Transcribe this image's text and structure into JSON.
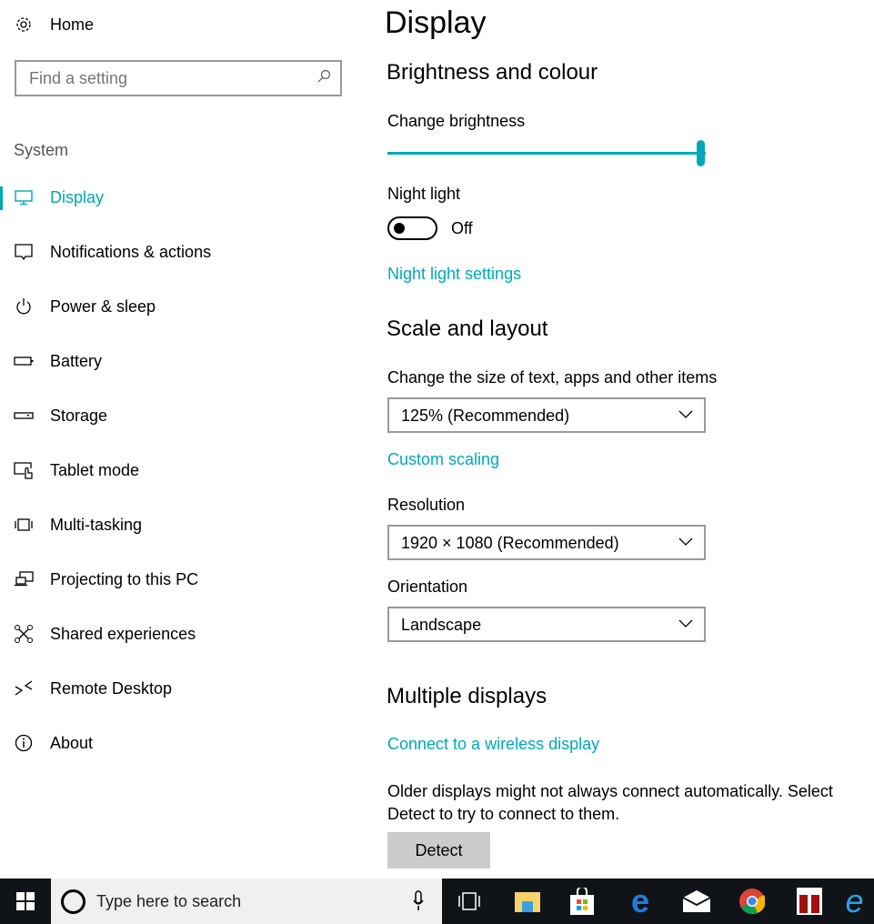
{
  "sidebar": {
    "home": "Home",
    "search_placeholder": "Find a setting",
    "section": "System",
    "items": [
      {
        "label": "Display",
        "icon": "monitor-icon"
      },
      {
        "label": "Notifications & actions",
        "icon": "notification-icon"
      },
      {
        "label": "Power & sleep",
        "icon": "power-icon"
      },
      {
        "label": "Battery",
        "icon": "battery-icon"
      },
      {
        "label": "Storage",
        "icon": "storage-icon"
      },
      {
        "label": "Tablet mode",
        "icon": "tablet-mode-icon"
      },
      {
        "label": "Multi-tasking",
        "icon": "multitasking-icon"
      },
      {
        "label": "Projecting to this PC",
        "icon": "projecting-icon"
      },
      {
        "label": "Shared experiences",
        "icon": "shared-experiences-icon"
      },
      {
        "label": "Remote Desktop",
        "icon": "remote-desktop-icon"
      },
      {
        "label": "About",
        "icon": "info-icon"
      }
    ]
  },
  "main": {
    "title": "Display",
    "brightness": {
      "heading": "Brightness and colour",
      "label": "Change brightness",
      "value_percent": 100
    },
    "night_light": {
      "label": "Night light",
      "state": "Off",
      "settings_link": "Night light settings"
    },
    "scale": {
      "heading": "Scale and layout",
      "size_label": "Change the size of text, apps and other items",
      "size_value": "125% (Recommended)",
      "custom_link": "Custom scaling",
      "resolution_label": "Resolution",
      "resolution_value": "1920 × 1080 (Recommended)",
      "orientation_label": "Orientation",
      "orientation_value": "Landscape"
    },
    "multiple": {
      "heading": "Multiple displays",
      "connect_link": "Connect to a wireless display",
      "note": "Older displays might not always connect automatically. Select Detect to try to connect to them.",
      "detect": "Detect"
    }
  },
  "taskbar": {
    "search_placeholder": "Type here to search"
  },
  "colors": {
    "accent": "#00a8b8",
    "taskbar": "#101418"
  }
}
